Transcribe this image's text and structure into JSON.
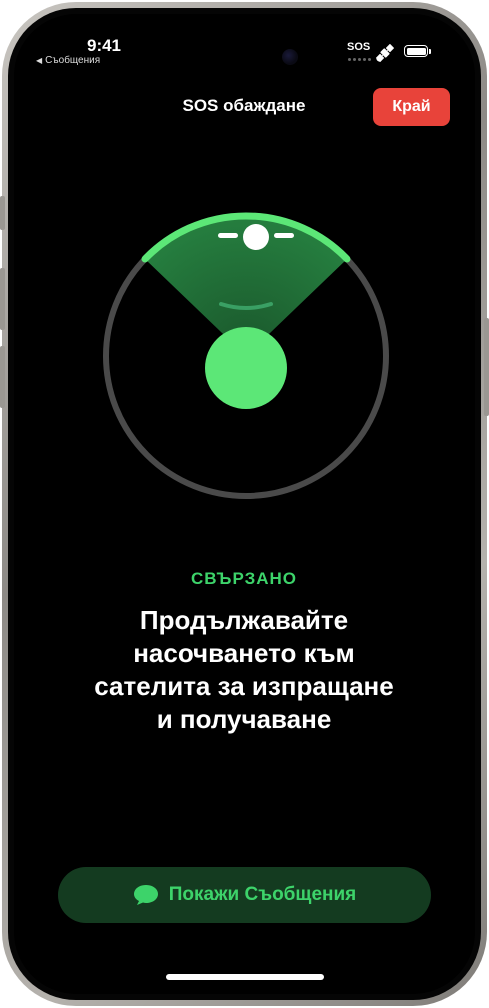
{
  "status_bar": {
    "time": "9:41",
    "back_label": "Съобщения",
    "sos_label": "SOS"
  },
  "header": {
    "title": "SOS обаждане",
    "end_button_label": "Край"
  },
  "connection": {
    "status": "СВЪРЗАНО",
    "instruction": "Продължавайте насочването към сателита за изпращане и получаване"
  },
  "actions": {
    "show_messages_label": "Покажи Съобщения"
  },
  "icons": {
    "back": "back-arrow-icon",
    "satellite": "satellite-icon",
    "battery": "battery-icon",
    "messages": "message-bubble-icon"
  },
  "colors": {
    "accent_green": "#3dd36a",
    "end_red": "#e8433a",
    "button_bg": "#143b20"
  }
}
